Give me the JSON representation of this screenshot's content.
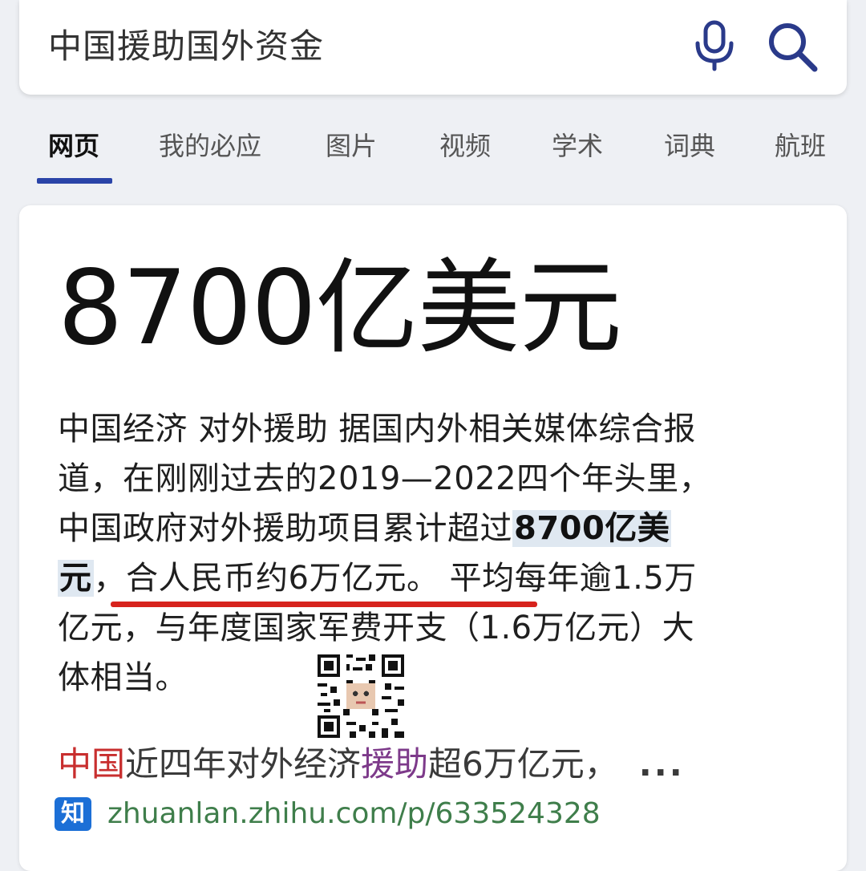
{
  "search": {
    "query": "中国援助国外资金",
    "mic_icon": "microphone-icon",
    "search_icon": "magnifier-icon"
  },
  "tabs": [
    {
      "label": "网页",
      "active": true
    },
    {
      "label": "我的必应"
    },
    {
      "label": "图片"
    },
    {
      "label": "视频"
    },
    {
      "label": "学术"
    },
    {
      "label": "词典"
    },
    {
      "label": "航班"
    }
  ],
  "answer": {
    "headline": "8700亿美元",
    "snippet": {
      "line1": "中国经济 对外援助 据国内外相关媒体综合报",
      "line2": "道，在刚刚过去的2019—2022四个年头里，",
      "line3_pre": "中国政府对外援助项目累计超过",
      "line3_hl": "8700亿美",
      "line4_hl": "元",
      "line4_post": "，合人民币约6万亿元。 平均每年逾1.5万",
      "line5": "亿元，与年度国家军费开支（1.6万亿元）大",
      "line6": "体相当。"
    },
    "highlight_color": "#dfe8f1",
    "underline_color": "#d7231d"
  },
  "result": {
    "title_part1": "中国",
    "title_part2": "近四年对外经济",
    "title_part3": "援助",
    "title_part4": "超6万亿元，",
    "ellipsis": "...",
    "source_icon_label": "知",
    "source_url": "zhuanlan.zhihu.com/p/633524328"
  },
  "colors": {
    "tab_accent": "#2a44a8",
    "url_green": "#3f7e4b",
    "zhihu_blue": "#1c6fd6"
  }
}
